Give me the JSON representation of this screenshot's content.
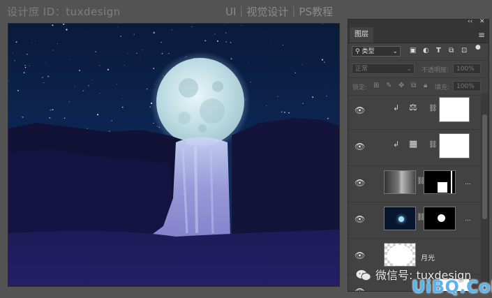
{
  "watermark": {
    "left": "设计庶 ID：tuxdesign",
    "right": "UI｜视觉设计｜PS教程"
  },
  "panel": {
    "collapse_icon": "double-chevron-icon",
    "close_icon": "close-icon",
    "tab_label": "图层",
    "menu_icon": "hamburger-menu-icon",
    "filter_label": "类型",
    "blend_mode": "正常",
    "opacity_label": "不透明度:",
    "opacity_value": "100%",
    "lock_label": "锁定:",
    "fill_label": "填充:",
    "fill_value": "100%"
  },
  "layers": [
    {
      "type": "balance-adjustment",
      "clipped": true,
      "name": ""
    },
    {
      "type": "levels-adjustment",
      "clipped": true,
      "name": ""
    },
    {
      "type": "smart-object-with-mask",
      "name": "...",
      "thumb": "waterfall"
    },
    {
      "type": "smart-object-with-mask",
      "name": "...",
      "thumb": "moon-in-sky"
    },
    {
      "type": "smart-object",
      "name": "月光",
      "thumb": "white-glow"
    },
    {
      "type": "partial",
      "name": ""
    }
  ],
  "overlay": {
    "wechat_text": "微信号: tuxdesign",
    "site_logo": "UiBQ.CoM"
  },
  "colors": {
    "app_background": "#535353",
    "panel_background": "#424242",
    "sky_top": "#0a1a3a",
    "ground": "#1d1a58",
    "waterfall": "#9b99dd",
    "moon_glow": "#dff3ff",
    "logo_blue": "#5ab4ee"
  }
}
